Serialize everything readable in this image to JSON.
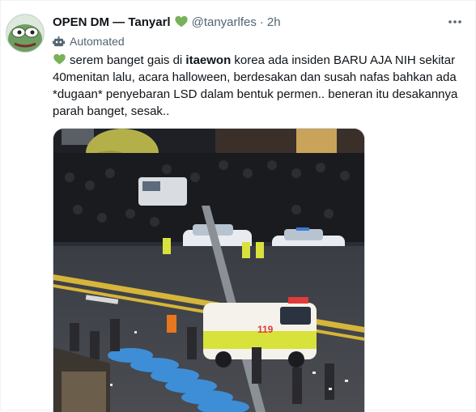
{
  "tweet": {
    "author_name": "OPEN DM — Tanyarl",
    "author_emoji": "green-heart",
    "handle": "@tanyarlfes",
    "separator": "·",
    "time": "2h",
    "automated_label": "Automated",
    "text_line1_pre": "serem banget gais di ",
    "text_line1_bold": "itaewon",
    "text_line1_post": " korea ada insiden BARU AJA NIH sekitar",
    "text_line2": "40menitan lalu, acara halloween, berdesakan dan susah nafas bahkan ada",
    "text_line3": "*dugaan* penyebaran LSD dalam bentuk permen.. beneran itu desakannya",
    "text_line4": "parah banget, sesak..",
    "photo_description_icon": "street-crowd-photo",
    "ambulance_number": "119"
  },
  "colors": {
    "heart_green": "#78b159",
    "text_primary": "#0f1419",
    "text_secondary": "#536471",
    "border": "#cfd9de"
  }
}
